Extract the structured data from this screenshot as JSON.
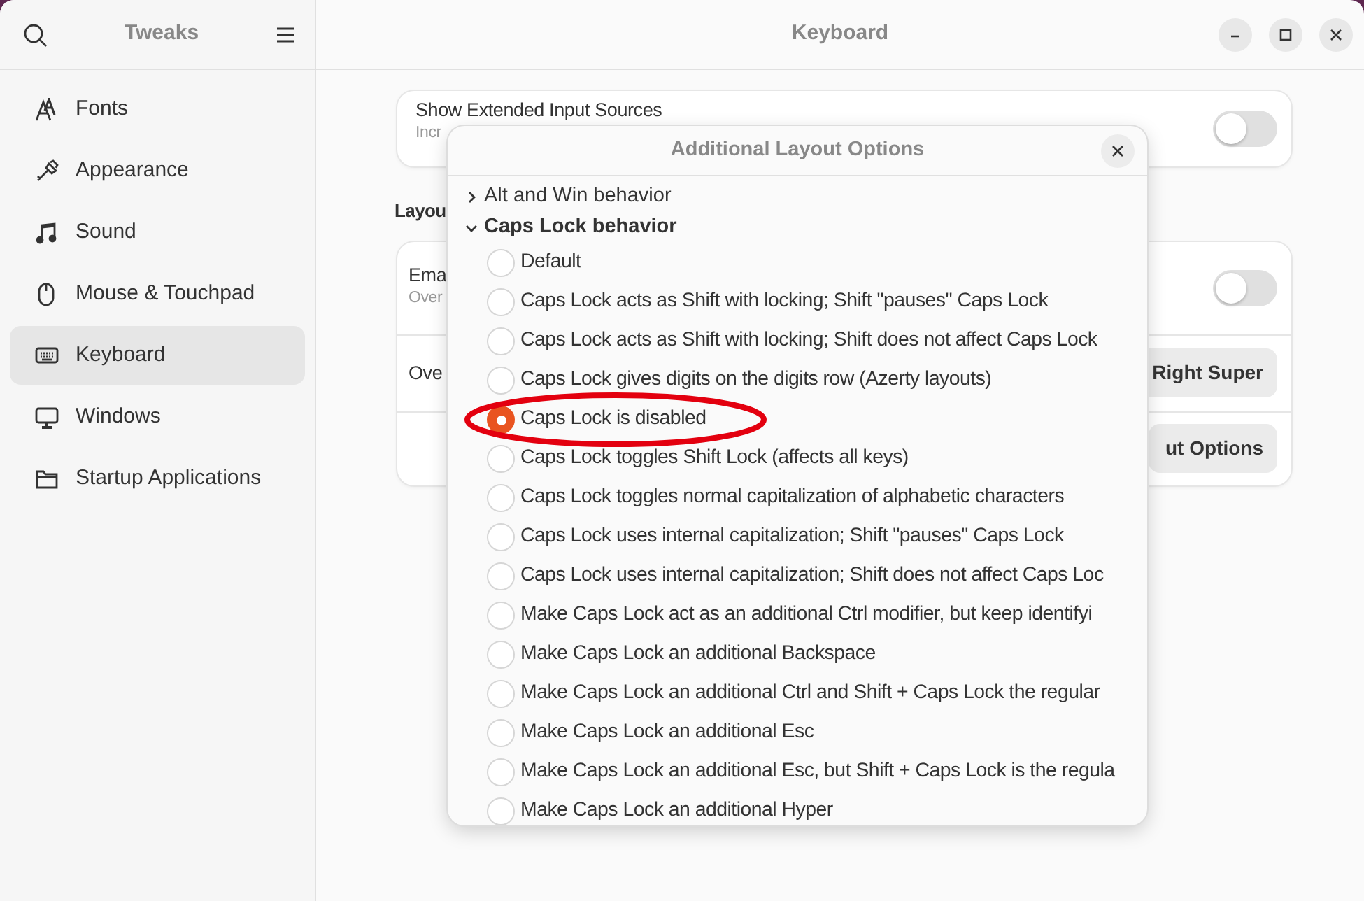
{
  "sidebar": {
    "title": "Tweaks",
    "items": [
      {
        "label": "Fonts",
        "selected": false
      },
      {
        "label": "Appearance",
        "selected": false
      },
      {
        "label": "Sound",
        "selected": false
      },
      {
        "label": "Mouse & Touchpad",
        "selected": false
      },
      {
        "label": "Keyboard",
        "selected": true
      },
      {
        "label": "Windows",
        "selected": false
      },
      {
        "label": "Startup Applications",
        "selected": false
      }
    ]
  },
  "content": {
    "title": "Keyboard",
    "top_card": {
      "title": "Show Extended Input Sources",
      "subtitle": "Incr",
      "on": false
    },
    "section_heading": "Layou",
    "rows": [
      {
        "kind": "toggle",
        "title": "Ema",
        "subtitle": "Over",
        "on": false
      },
      {
        "kind": "button",
        "title": "Ove",
        "button": "Right Super"
      },
      {
        "kind": "button",
        "button": "ut Options"
      }
    ]
  },
  "dialog": {
    "title": "Additional Layout Options",
    "groups": [
      {
        "label": "Alt and Win behavior",
        "expanded": false
      },
      {
        "label": "Caps Lock behavior",
        "expanded": true,
        "options": [
          {
            "label": "Default",
            "selected": false
          },
          {
            "label": "Caps Lock acts as Shift with locking; Shift \"pauses\" Caps Lock",
            "selected": false
          },
          {
            "label": "Caps Lock acts as Shift with locking; Shift does not affect Caps Lock",
            "selected": false
          },
          {
            "label": "Caps Lock gives digits on the digits row (Azerty layouts)",
            "selected": false
          },
          {
            "label": "Caps Lock is disabled",
            "selected": true,
            "circled": true
          },
          {
            "label": "Caps Lock toggles Shift Lock (affects all keys)",
            "selected": false
          },
          {
            "label": "Caps Lock toggles normal capitalization of alphabetic characters",
            "selected": false
          },
          {
            "label": "Caps Lock uses internal capitalization; Shift \"pauses\" Caps Lock",
            "selected": false
          },
          {
            "label": "Caps Lock uses internal capitalization; Shift does not affect Caps Loc",
            "selected": false
          },
          {
            "label": "Make Caps Lock act as an additional Ctrl modifier, but keep identifyi",
            "selected": false
          },
          {
            "label": "Make Caps Lock an additional Backspace",
            "selected": false
          },
          {
            "label": "Make Caps Lock an additional Ctrl and Shift + Caps Lock the regular",
            "selected": false
          },
          {
            "label": "Make Caps Lock an additional Esc",
            "selected": false
          },
          {
            "label": "Make Caps Lock an additional Esc, but Shift + Caps Lock is the regula",
            "selected": false
          },
          {
            "label": "Make Caps Lock an additional Hyper",
            "selected": false
          }
        ]
      }
    ]
  }
}
